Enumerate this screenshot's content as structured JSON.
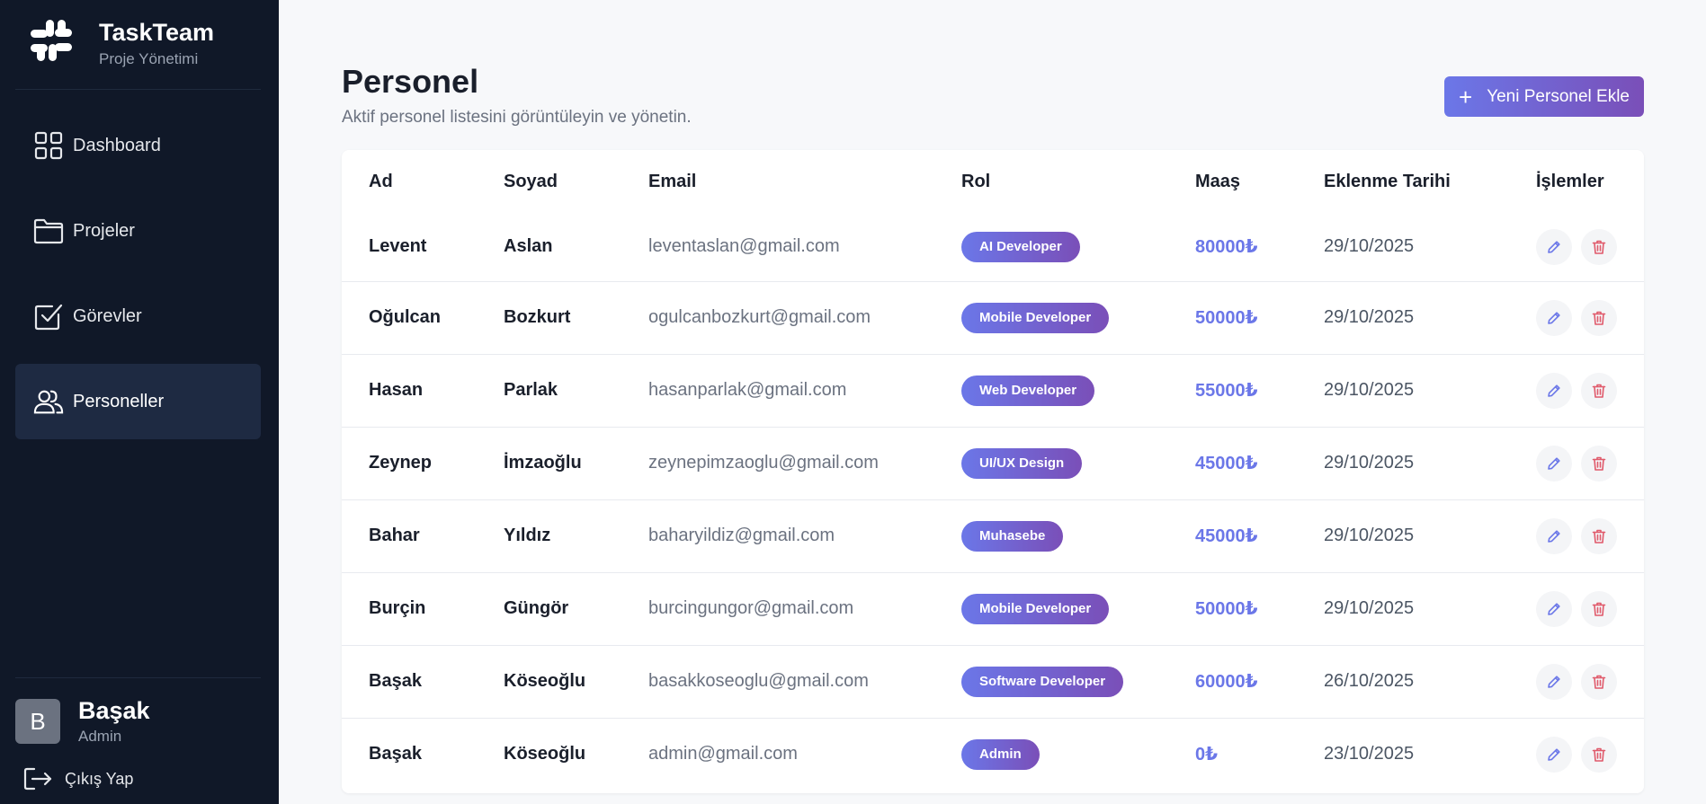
{
  "brand": {
    "title": "TaskTeam",
    "subtitle": "Proje Yönetimi"
  },
  "nav": [
    {
      "label": "Dashboard",
      "icon": "dashboard-grid-icon",
      "active": false
    },
    {
      "label": "Projeler",
      "icon": "folder-icon",
      "active": false
    },
    {
      "label": "Görevler",
      "icon": "checkbox-icon",
      "active": false
    },
    {
      "label": "Personeller",
      "icon": "users-icon",
      "active": true
    }
  ],
  "user": {
    "initial": "B",
    "name": "Başak",
    "role": "Admin",
    "logout_label": "Çıkış Yap"
  },
  "page": {
    "title": "Personel",
    "subtitle": "Aktif personel listesini görüntüleyin ve yönetin.",
    "add_button": "Yeni Personel Ekle"
  },
  "table": {
    "headers": [
      "Ad",
      "Soyad",
      "Email",
      "Rol",
      "Maaş",
      "Eklenme Tarihi",
      "İşlemler"
    ],
    "rows": [
      {
        "ad": "Levent",
        "soyad": "Aslan",
        "email": "leventaslan@gmail.com",
        "rol": "AI Developer",
        "maas": "80000₺",
        "tarih": "29/10/2025"
      },
      {
        "ad": "Oğulcan",
        "soyad": "Bozkurt",
        "email": "ogulcanbozkurt@gmail.com",
        "rol": "Mobile Developer",
        "maas": "50000₺",
        "tarih": "29/10/2025"
      },
      {
        "ad": "Hasan",
        "soyad": "Parlak",
        "email": "hasanparlak@gmail.com",
        "rol": "Web Developer",
        "maas": "55000₺",
        "tarih": "29/10/2025"
      },
      {
        "ad": "Zeynep",
        "soyad": "İmzaoğlu",
        "email": "zeynepimzaoglu@gmail.com",
        "rol": "UI/UX Design",
        "maas": "45000₺",
        "tarih": "29/10/2025"
      },
      {
        "ad": "Bahar",
        "soyad": "Yıldız",
        "email": "baharyildiz@gmail.com",
        "rol": "Muhasebe",
        "maas": "45000₺",
        "tarih": "29/10/2025"
      },
      {
        "ad": "Burçin",
        "soyad": "Güngör",
        "email": "burcingungor@gmail.com",
        "rol": "Mobile Developer",
        "maas": "50000₺",
        "tarih": "29/10/2025"
      },
      {
        "ad": "Başak",
        "soyad": "Köseoğlu",
        "email": "basakkoseoglu@gmail.com",
        "rol": "Software Developer",
        "maas": "60000₺",
        "tarih": "26/10/2025"
      },
      {
        "ad": "Başak",
        "soyad": "Köseoğlu",
        "email": "admin@gmail.com",
        "rol": "Admin",
        "maas": "0₺",
        "tarih": "23/10/2025"
      }
    ],
    "action_icons": [
      "pencil-icon",
      "trash-icon"
    ]
  },
  "colors": {
    "sidebar": "#101828",
    "active_nav": "#1e2a42",
    "accent": "#6b77e8",
    "accent_end": "#7a4fb8",
    "delete": "#e05a6b"
  }
}
